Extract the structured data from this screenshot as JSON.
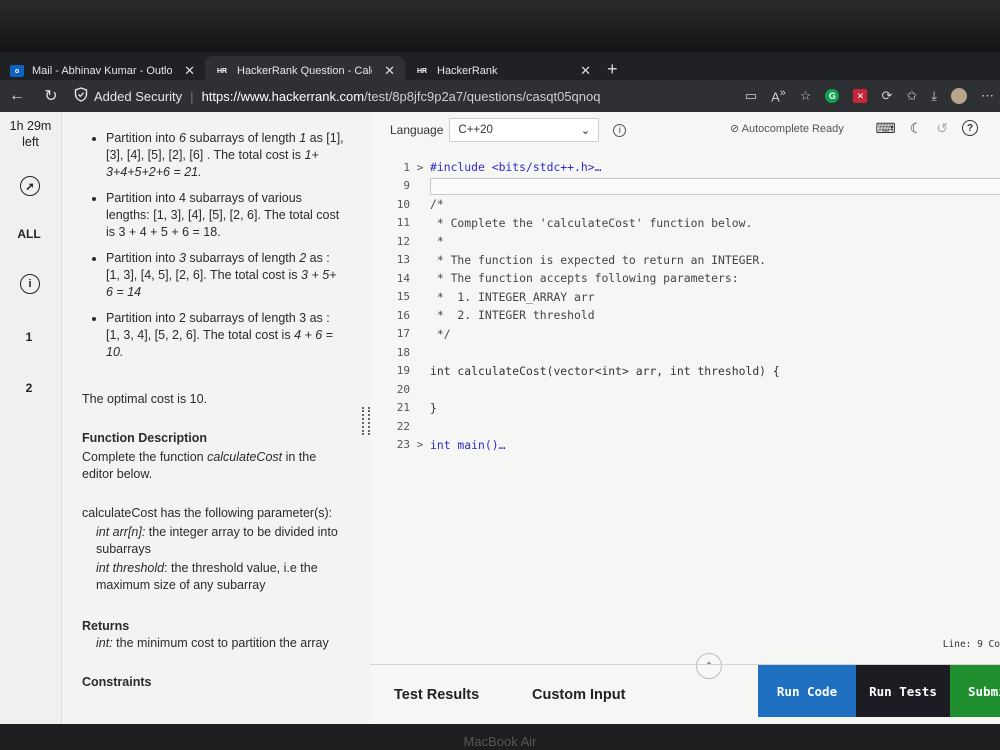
{
  "browser": {
    "tabs": [
      {
        "label": "Mail - Abhinav Kumar - Outloo",
        "favicon": "outlook-icon",
        "active": false
      },
      {
        "label": "HackerRank Question - Calcul",
        "favicon": "hackerrank-icon",
        "active": true
      },
      {
        "label": "HackerRank",
        "favicon": "hackerrank-icon",
        "active": false
      }
    ],
    "security_label": "Added Security",
    "url_host": "https://www.hackerrank.com",
    "url_path": "/test/8p8jfc9p2a7/questions/casqt05qnoq"
  },
  "rail": {
    "timer_line1": "1h 29m",
    "timer_line2": "left",
    "all_label": "ALL",
    "q1": "1",
    "q2": "2"
  },
  "problem": {
    "bullets": [
      {
        "pre": "Partition into ",
        "em1": "6",
        "mid": " subarrays of length ",
        "em2": "1",
        "rest": " as [1], [3], [4], [5], [2], [6] . The total cost is ",
        "em3": "1+ 3+4+5+2+6 = 21."
      },
      {
        "pre": "Partition into 4 subarrays of various lengths: [1, 3], [4], [5], [2, 6]. The total cost is 3 + 4 + 5 + 6 = 18.",
        "em1": "",
        "mid": "",
        "em2": "",
        "rest": "",
        "em3": ""
      },
      {
        "pre": "Partition into ",
        "em1": "3",
        "mid": " subarrays of length ",
        "em2": "2",
        "rest": " as : [1, 3], [4, 5], [2, 6]. The total cost is ",
        "em3": "3 + 5+ 6 = 14"
      },
      {
        "pre": "Partition into 2 subarrays of length 3 as : [1, 3, 4], [5, 2, 6]. The total cost is ",
        "em1": "",
        "mid": "",
        "em2": "",
        "rest": "",
        "em3": "4 + 6 = 10."
      }
    ],
    "optimal": "The optimal cost is 10.",
    "fd_heading": "Function Description",
    "fd_pre": "Complete the function ",
    "fd_em": "calculateCost",
    "fd_post": " in the editor below.",
    "params_intro": "calculateCost has the following parameter(s):",
    "p1_em": "int arr[n]:",
    "p1_text": " the integer array to be divided into subarrays",
    "p2_em": "int threshold",
    "p2_text": ": the threshold value, i.e the maximum size of any subarray",
    "returns_heading": "Returns",
    "returns_em": "int:",
    "returns_text": " the minimum cost to partition the array",
    "constraints_heading": "Constraints"
  },
  "editor": {
    "language_label": "Language",
    "language_value": "C++20",
    "autocomplete": "Autocomplete Ready",
    "lines": [
      {
        "n": "1",
        "fold": ">",
        "text": "#include <bits/stdc++.h>…",
        "kind": "include"
      },
      {
        "n": "9",
        "fold": "",
        "text": "",
        "kind": "cursor"
      },
      {
        "n": "10",
        "fold": "",
        "text": "/*",
        "kind": "cm"
      },
      {
        "n": "11",
        "fold": "",
        "text": " * Complete the 'calculateCost' function below.",
        "kind": "cm"
      },
      {
        "n": "12",
        "fold": "",
        "text": " *",
        "kind": "cm"
      },
      {
        "n": "13",
        "fold": "",
        "text": " * The function is expected to return an INTEGER.",
        "kind": "cm"
      },
      {
        "n": "14",
        "fold": "",
        "text": " * The function accepts following parameters:",
        "kind": "cm"
      },
      {
        "n": "15",
        "fold": "",
        "text": " *  1. INTEGER_ARRAY arr",
        "kind": "cm"
      },
      {
        "n": "16",
        "fold": "",
        "text": " *  2. INTEGER threshold",
        "kind": "cm"
      },
      {
        "n": "17",
        "fold": "",
        "text": " */",
        "kind": "cm"
      },
      {
        "n": "18",
        "fold": "",
        "text": "",
        "kind": "plain"
      },
      {
        "n": "19",
        "fold": "",
        "text": "int calculateCost(vector<int> arr, int threshold) {",
        "kind": "sig"
      },
      {
        "n": "20",
        "fold": "",
        "text": "",
        "kind": "plain"
      },
      {
        "n": "21",
        "fold": "",
        "text": "}",
        "kind": "plain"
      },
      {
        "n": "22",
        "fold": "",
        "text": "",
        "kind": "plain"
      },
      {
        "n": "23",
        "fold": ">",
        "text": "int main()…",
        "kind": "main"
      }
    ],
    "status": "Line: 9 Co",
    "test_results_tab": "Test Results",
    "custom_input_tab": "Custom Input",
    "run_code": "Run Code",
    "run_tests": "Run Tests",
    "submit": "Submi"
  },
  "device_brand": "MacBook Air"
}
